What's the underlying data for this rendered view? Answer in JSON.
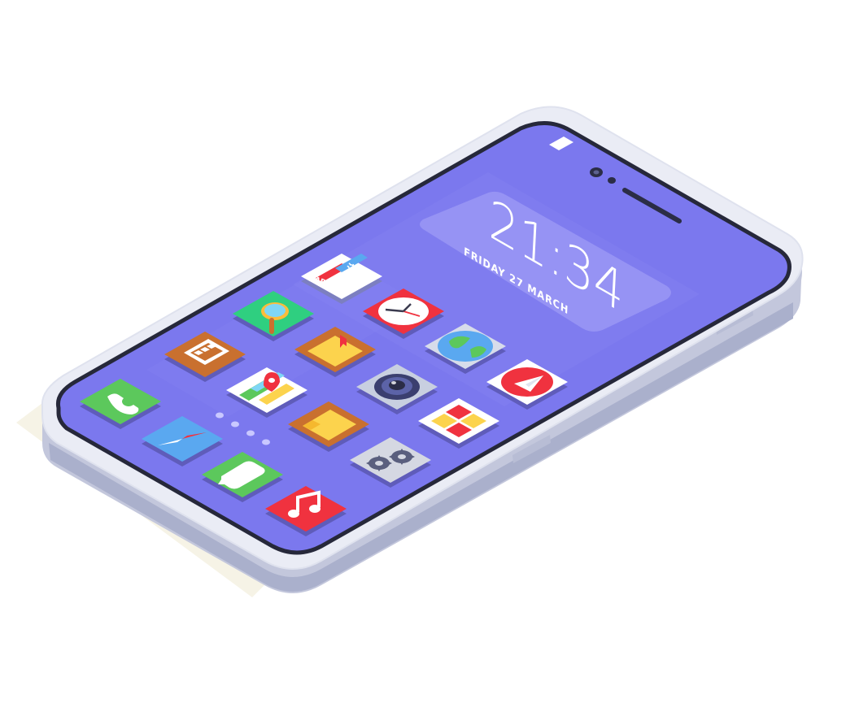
{
  "lockscreen": {
    "time": "21:34",
    "date": "FRIDAY 27 MARCH"
  },
  "apps": [
    {
      "name": "translate",
      "label_latin": "ABC",
      "label_cjk": "漢",
      "color": "#ffffff",
      "icon": "translate-icon"
    },
    {
      "name": "search",
      "color": "#2fcf80",
      "icon": "magnifier-icon"
    },
    {
      "name": "clock",
      "color": "#f0323f",
      "icon": "clock-icon"
    },
    {
      "name": "battery",
      "color": "#c9702f",
      "icon": "battery-icon"
    },
    {
      "name": "notes",
      "color": "#c9702f",
      "icon": "bookmark-box-icon"
    },
    {
      "name": "globe",
      "color": "#d7dcea",
      "icon": "globe-icon"
    },
    {
      "name": "maps",
      "color": "#ffffff",
      "icon": "map-pin-icon"
    },
    {
      "name": "camera",
      "color": "#c8cfe0",
      "icon": "camera-icon"
    },
    {
      "name": "send",
      "color": "#ffffff",
      "icon": "paper-plane-icon"
    },
    {
      "name": "phone",
      "color": "#5cc85c",
      "icon": "phone-icon"
    },
    {
      "name": "folder",
      "color": "#c9702f",
      "icon": "folder-icon"
    },
    {
      "name": "help",
      "color": "#ffffff",
      "icon": "lifebuoy-icon"
    },
    {
      "name": "compass",
      "color": "#5aa8f0",
      "icon": "compass-icon"
    },
    {
      "name": "settings",
      "color": "#d5d8e2",
      "icon": "gears-icon"
    },
    {
      "name": "messages",
      "color": "#5cc85c",
      "icon": "chat-bubble-icon"
    },
    {
      "name": "music",
      "color": "#f0323f",
      "icon": "music-note-icon"
    }
  ],
  "colors": {
    "screen": "#7b78ee",
    "bezel": "#eaecf5",
    "frame_side": "#c3c7dc",
    "shadow": "#f6f3e6"
  }
}
